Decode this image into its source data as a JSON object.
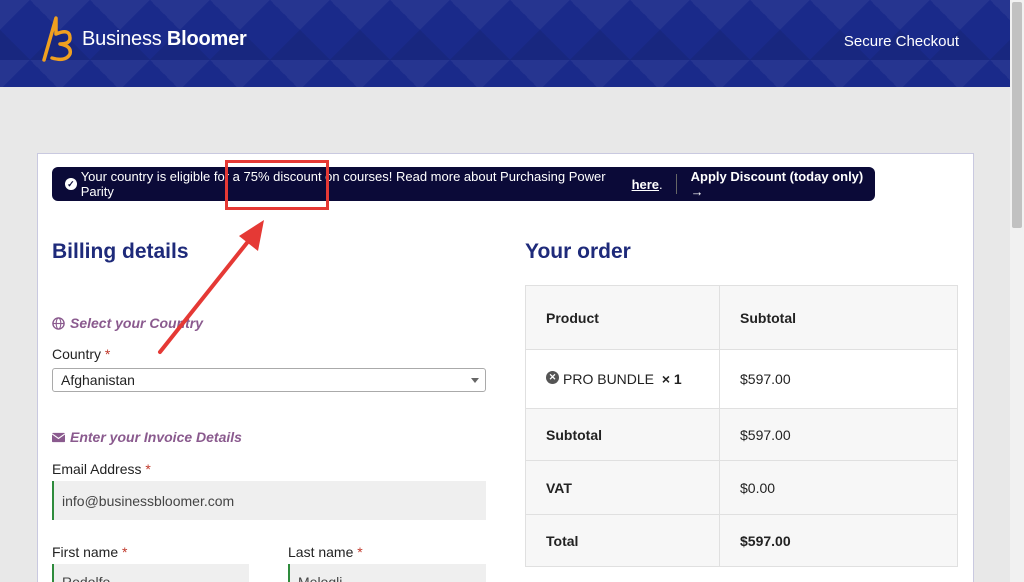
{
  "header": {
    "brand_light": "Business",
    "brand_bold": "Bloomer",
    "secure_checkout": "Secure Checkout"
  },
  "notice": {
    "text": "Your country is eligible for a 75% discount on courses! Read more about Purchasing Power Parity",
    "link": "here",
    "period": ".",
    "apply": "Apply Discount (today only)",
    "apply_arrow": "→"
  },
  "billing": {
    "title": "Billing details",
    "country_section": "Select your Country",
    "country_label": "Country",
    "country_value": "Afghanistan",
    "invoice_section": "Enter your Invoice Details",
    "email_label": "Email Address",
    "email_value": "info@businessbloomer.com",
    "first_name_label": "First name",
    "first_name_value": "Rodolfo",
    "last_name_label": "Last name",
    "last_name_value": "Melogli",
    "required_mark": "*"
  },
  "order": {
    "title": "Your order",
    "headers": [
      "Product",
      "Subtotal"
    ],
    "product_name": "PRO BUNDLE",
    "product_qty": "× 1",
    "product_price": "$597.00",
    "subtotal_label": "Subtotal",
    "subtotal_value": "$597.00",
    "vat_label": "VAT",
    "vat_value": "$0.00",
    "total_label": "Total",
    "total_value": "$597.00"
  },
  "colors": {
    "header_bg": "#1a2a8a",
    "notice_bg": "#0b0a38",
    "heading": "#1e2a7a",
    "section_label": "#8a5a8e",
    "highlight": "#e53935"
  }
}
